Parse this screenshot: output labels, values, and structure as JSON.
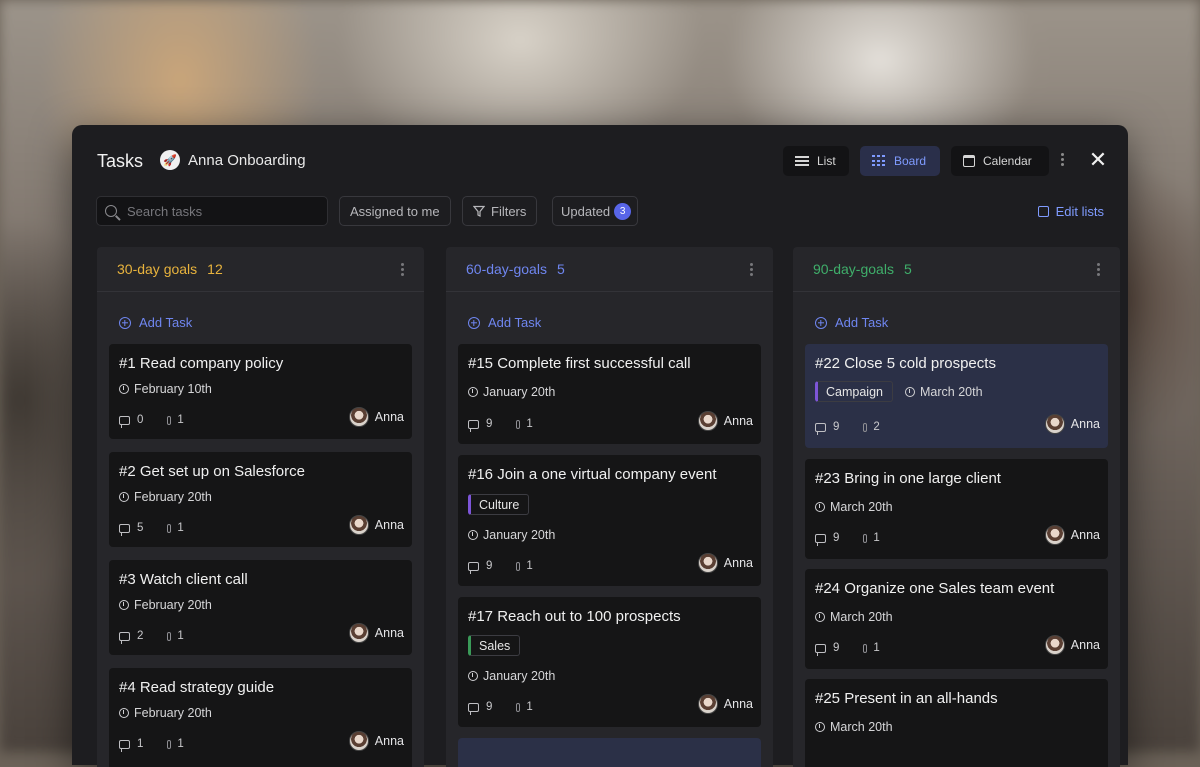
{
  "header": {
    "title": "Tasks",
    "project_icon": "rocket-icon",
    "project_name": "Anna Onboarding",
    "views": [
      {
        "label": "List",
        "icon": "list-icon",
        "active": false
      },
      {
        "label": "Board",
        "icon": "board-icon",
        "active": true
      },
      {
        "label": "Calendar",
        "icon": "calendar-icon",
        "active": false
      }
    ]
  },
  "toolbar": {
    "search_placeholder": "Search tasks",
    "assigned_label": "Assigned to me",
    "filters_label": "Filters",
    "updated_label": "Updated",
    "updated_count": "3",
    "edit_lists_label": "Edit lists"
  },
  "colors": {
    "accent": "#7f9bff",
    "col1": "#e8b33d",
    "col2": "#6f86f0",
    "col3": "#3fae6a"
  },
  "add_task_label": "Add Task",
  "columns": [
    {
      "title": "30-day goals",
      "count": "12",
      "cards": [
        {
          "title": "#1  Read company policy",
          "date": "February 10th",
          "comments": "0",
          "attachments": "1",
          "assignee": "Anna"
        },
        {
          "title": "#2  Get set up on Salesforce",
          "date": "February 20th",
          "comments": "5",
          "attachments": "1",
          "assignee": "Anna"
        },
        {
          "title": "#3  Watch client call",
          "date": "February 20th",
          "comments": "2",
          "attachments": "1",
          "assignee": "Anna"
        },
        {
          "title": "#4  Read strategy guide",
          "date": "February 20th",
          "comments": "1",
          "attachments": "1",
          "assignee": "Anna"
        }
      ]
    },
    {
      "title": "60-day-goals",
      "count": "5",
      "cards": [
        {
          "title": "#15  Complete first successful call",
          "date": "January 20th",
          "comments": "9",
          "attachments": "1",
          "assignee": "Anna"
        },
        {
          "title": "#16  Join a one virtual company event",
          "tag": "Culture",
          "date": "January 20th",
          "comments": "9",
          "attachments": "1",
          "assignee": "Anna"
        },
        {
          "title": "#17  Reach out to 100 prospects",
          "tag": "Sales",
          "date": "January 20th",
          "comments": "9",
          "attachments": "1",
          "assignee": "Anna"
        }
      ]
    },
    {
      "title": "90-day-goals",
      "count": "5",
      "cards": [
        {
          "title": "#22  Close 5 cold prospects",
          "tag": "Campaign",
          "date": "March 20th",
          "comments": "9",
          "attachments": "2",
          "assignee": "Anna"
        },
        {
          "title": "#23  Bring in one large client",
          "date": "March 20th",
          "comments": "9",
          "attachments": "1",
          "assignee": "Anna"
        },
        {
          "title": "#24  Organize one Sales team event",
          "date": "March 20th",
          "comments": "9",
          "attachments": "1",
          "assignee": "Anna"
        },
        {
          "title": "#25  Present in an all-hands",
          "date": "March 20th"
        }
      ]
    }
  ]
}
